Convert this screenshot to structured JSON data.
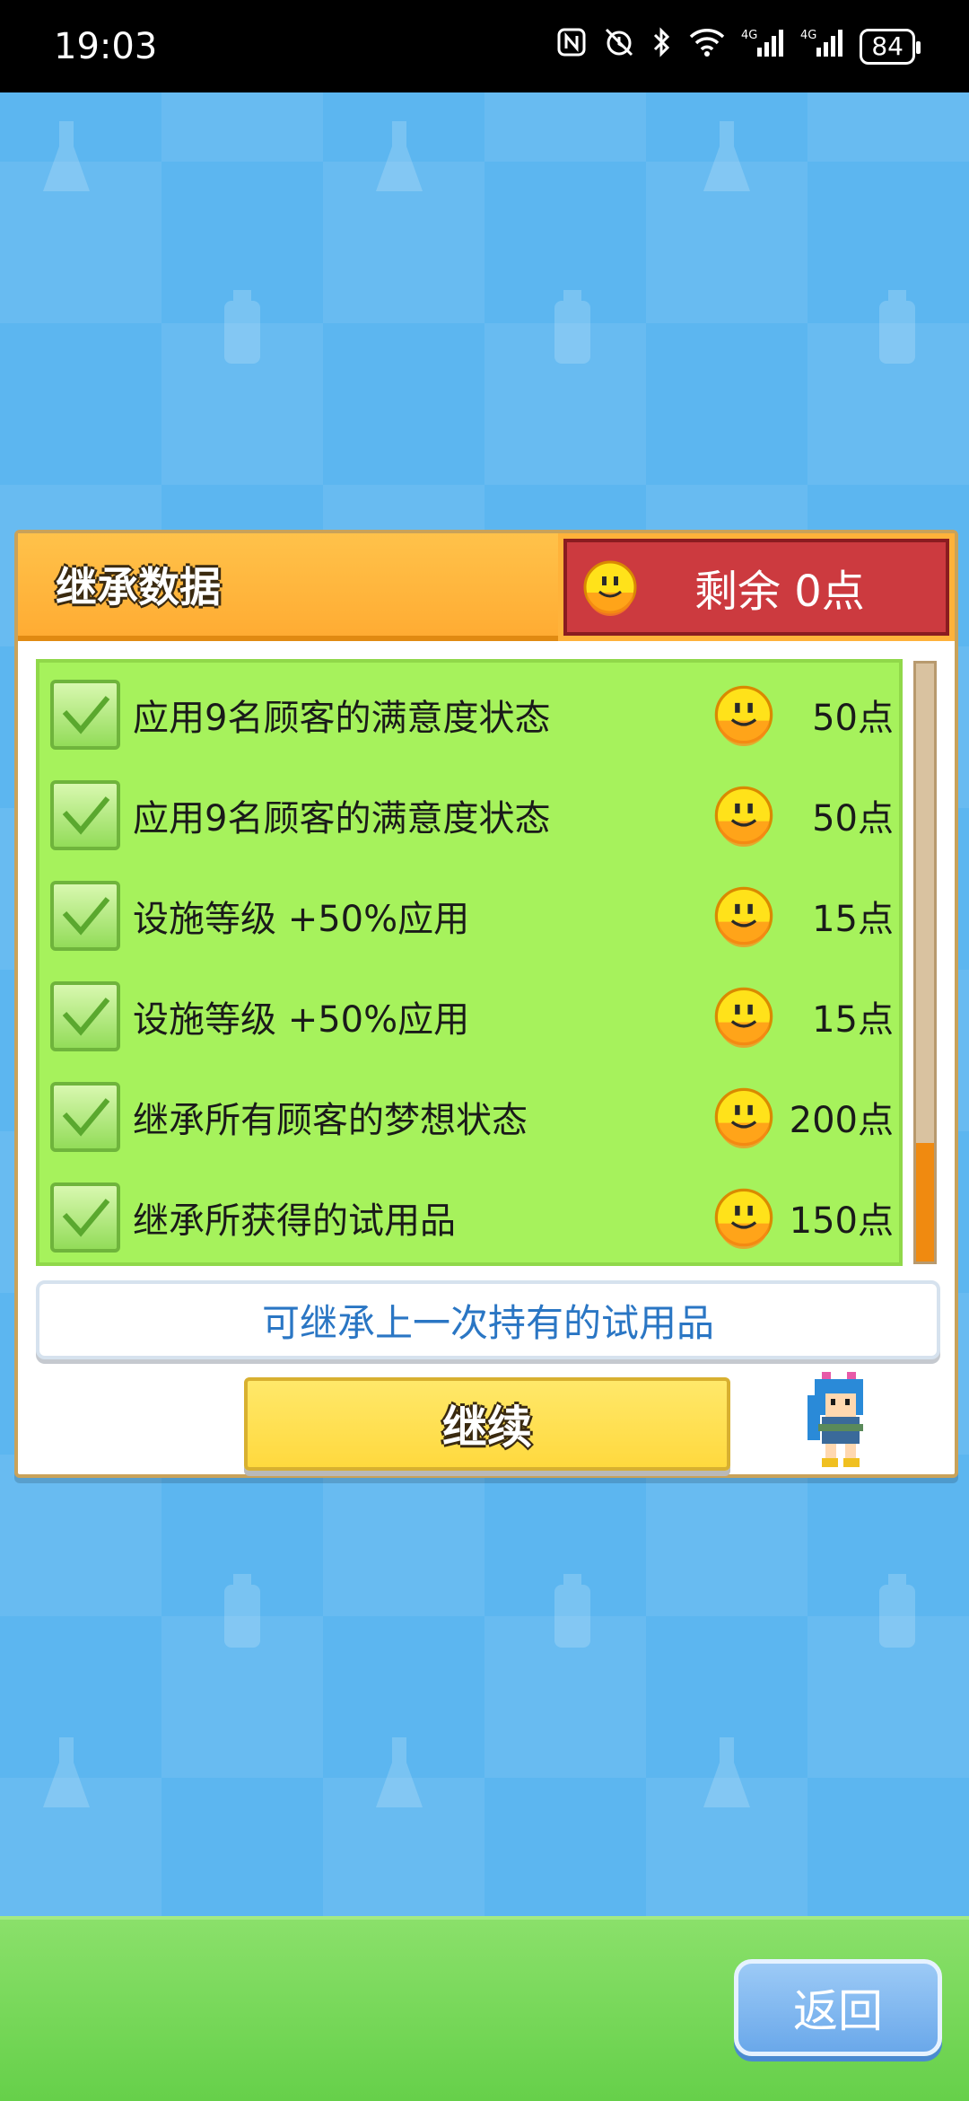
{
  "status_bar": {
    "time": "19:03",
    "icons": [
      "nfc-icon",
      "alarm-icon",
      "bluetooth-icon",
      "wifi-icon",
      "signal-4g-icon",
      "signal-4g-icon"
    ],
    "battery": "84"
  },
  "dialog": {
    "title": "继承数据",
    "remaining_points": "剩余 0点",
    "items": [
      {
        "label": "应用9名顾客的满意度状态",
        "cost": "50点",
        "checked": true
      },
      {
        "label": "应用9名顾客的满意度状态",
        "cost": "50点",
        "checked": true
      },
      {
        "label": "设施等级 +50%应用",
        "cost": "15点",
        "checked": true
      },
      {
        "label": "设施等级 +50%应用",
        "cost": "15点",
        "checked": true
      },
      {
        "label": "继承所有顾客的梦想状态",
        "cost": "200点",
        "checked": true
      },
      {
        "label": "继承所获得的试用品",
        "cost": "150点",
        "checked": true
      }
    ],
    "info": "可继承上一次持有的试用品",
    "continue_label": "继续"
  },
  "bottom": {
    "back_label": "返回"
  },
  "colors": {
    "background": "#5cb6f0",
    "title_tab": "#ffb23a",
    "points_box": "#cc3a3f",
    "list_bg": "#a6f25c",
    "continue_btn": "#ffd93e",
    "back_btn": "#6aa8ea",
    "bottom_bar": "#66d04a",
    "info_text": "#2a76c4"
  }
}
